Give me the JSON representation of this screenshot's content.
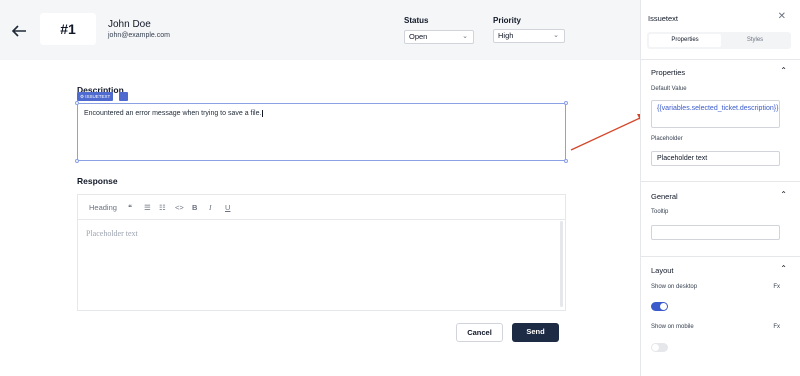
{
  "ticket": {
    "id": "#1",
    "user_name": "John Doe",
    "user_email": "john@example.com"
  },
  "status": {
    "label": "Status",
    "value": "Open"
  },
  "priority": {
    "label": "Priority",
    "value": "High"
  },
  "description": {
    "label": "Description",
    "widget_tag": "ISSUETEXT",
    "value": "Encountered an error message when trying to save a file."
  },
  "response": {
    "label": "Response",
    "toolbar": {
      "heading": "Heading",
      "quote": "❝",
      "bullets": "☰",
      "numbered": "☷",
      "code": "<>",
      "bold": "B",
      "italic": "I",
      "underline": "U"
    },
    "placeholder": "Placeholder text"
  },
  "actions": {
    "cancel": "Cancel",
    "send": "Send"
  },
  "panel": {
    "title": "Issuetext",
    "tabs": {
      "properties": "Properties",
      "styles": "Styles"
    },
    "properties_section": {
      "title": "Properties",
      "default_value_label": "Default Value",
      "default_value": "{{variables.selected_ticket.description}}",
      "placeholder_label": "Placeholder",
      "placeholder_value": "Placeholder text"
    },
    "general_section": {
      "title": "General",
      "tooltip_label": "Tooltip",
      "tooltip_value": ""
    },
    "layout_section": {
      "title": "Layout",
      "desktop_label": "Show on desktop",
      "mobile_label": "Show on mobile",
      "fx": "Fx",
      "desktop_on": true,
      "mobile_on": false
    }
  },
  "colors": {
    "accent": "#3b5bcc",
    "arrow": "#d4472a",
    "send_bg": "#1e2b44"
  }
}
